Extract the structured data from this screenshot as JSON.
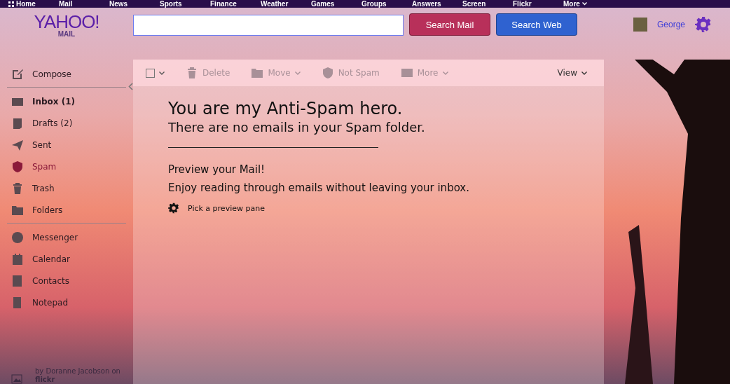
{
  "top_nav": [
    {
      "label": "Home",
      "kind": "home"
    },
    {
      "label": "Mail",
      "kind": "link"
    },
    {
      "label": "News",
      "kind": "link"
    },
    {
      "label": "Sports",
      "kind": "link"
    },
    {
      "label": "Finance",
      "kind": "link"
    },
    {
      "label": "Weather",
      "kind": "link"
    },
    {
      "label": "Games",
      "kind": "link"
    },
    {
      "label": "Groups",
      "kind": "link"
    },
    {
      "label": "Answers",
      "kind": "link"
    },
    {
      "label": "Screen",
      "kind": "link"
    },
    {
      "label": "Flickr",
      "kind": "link"
    },
    {
      "label": "More",
      "kind": "more"
    }
  ],
  "logo": {
    "brand": "YAHOO!",
    "product": "MAIL"
  },
  "search": {
    "search_mail": "Search Mail",
    "search_web": "Search Web"
  },
  "user": {
    "name": "George"
  },
  "sidebar": {
    "compose": "Compose",
    "folders": [
      {
        "label": "Inbox (1)",
        "selected": false,
        "unread": true
      },
      {
        "label": "Drafts (2)",
        "selected": false,
        "unread": false
      },
      {
        "label": "Sent",
        "selected": false,
        "unread": false
      },
      {
        "label": "Spam",
        "selected": true,
        "unread": false
      },
      {
        "label": "Trash",
        "selected": false,
        "unread": false
      },
      {
        "label": "Folders",
        "selected": false,
        "unread": false
      }
    ],
    "apps": [
      {
        "label": "Messenger"
      },
      {
        "label": "Calendar"
      },
      {
        "label": "Contacts"
      },
      {
        "label": "Notepad"
      }
    ],
    "credit": {
      "text": "by Doranne Jacobson on",
      "source": "flickr"
    }
  },
  "toolbar": {
    "select_all": {
      "checked": false
    },
    "actions": [
      {
        "label": "Delete",
        "disabled": true,
        "dropdown": false
      },
      {
        "label": "Move",
        "disabled": true,
        "dropdown": true
      },
      {
        "label": "Not Spam",
        "disabled": true,
        "dropdown": false
      },
      {
        "label": "More",
        "disabled": true,
        "dropdown": true
      }
    ],
    "view": "View"
  },
  "empty": {
    "title": "You are my Anti-Spam hero.",
    "subtitle": "There are no emails in your Spam folder.",
    "preview_title": "Preview your Mail!",
    "preview_text": "Enjoy reading through emails without leaving your inbox.",
    "preview_link": "Pick a preview pane"
  }
}
